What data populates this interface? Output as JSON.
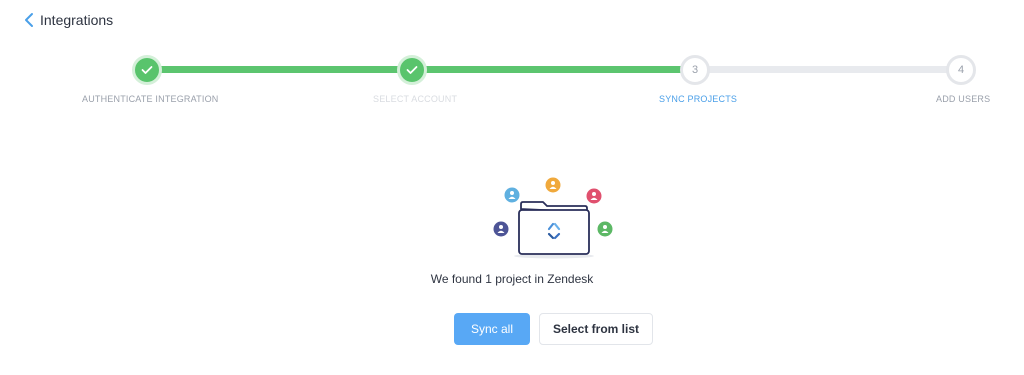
{
  "header": {
    "back_label": "Integrations"
  },
  "stepper": {
    "steps": [
      {
        "label": "AUTHENTICATE INTEGRATION",
        "state": "done",
        "number": ""
      },
      {
        "label": "SELECT ACCOUNT",
        "state": "done",
        "number": ""
      },
      {
        "label": "SYNC PROJECTS",
        "state": "active",
        "number": "3"
      },
      {
        "label": "ADD USERS",
        "state": "pending",
        "number": "4"
      }
    ],
    "colors": {
      "done": "#59c46c",
      "active_label": "#4a9fe8",
      "pending_label": "#9aa0ab",
      "faded_label": "#d9dce1"
    }
  },
  "illustration": {
    "icon": "folder-with-users-icon",
    "avatar_colors": [
      "#5fb0e0",
      "#f0a93c",
      "#e0506e",
      "#4d5496",
      "#5cb865"
    ]
  },
  "main": {
    "message": "We found 1 project in Zendesk",
    "primary_button": "Sync all",
    "secondary_button": "Select from list"
  }
}
